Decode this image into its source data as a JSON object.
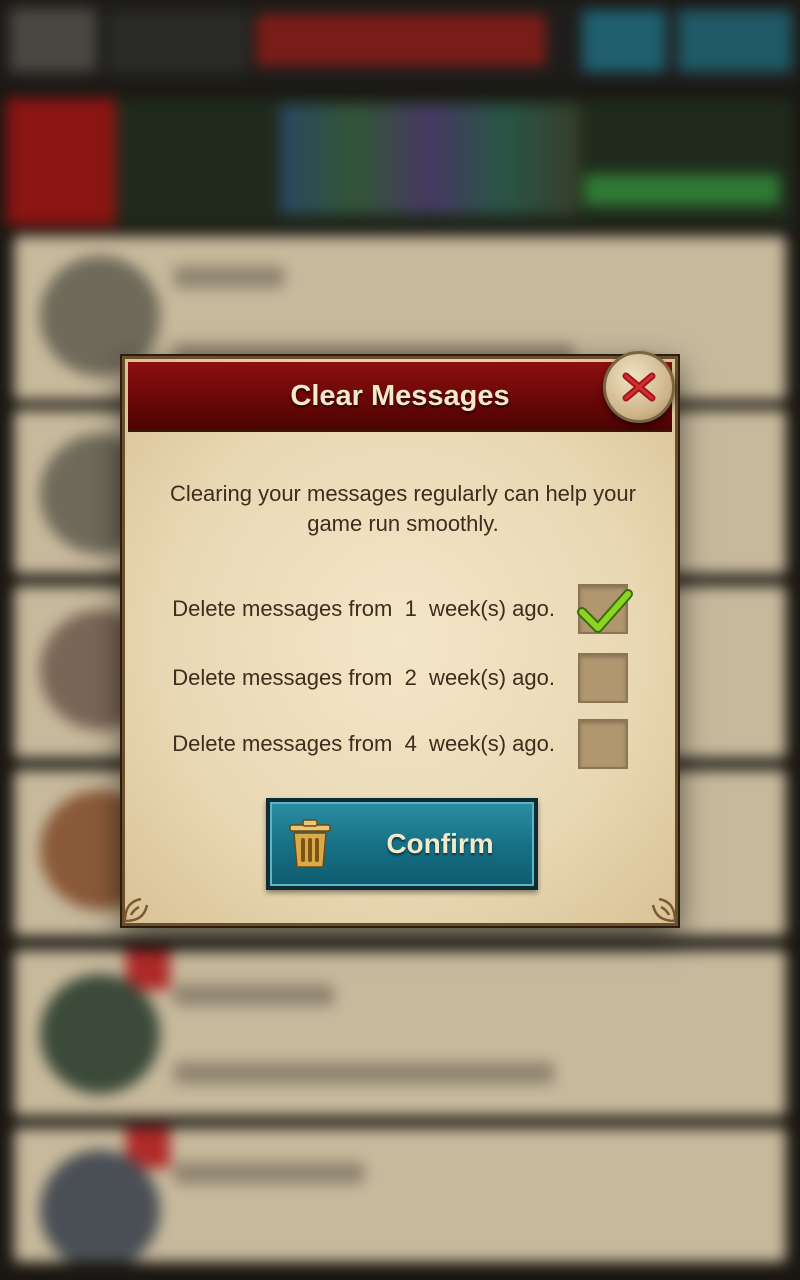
{
  "dialog": {
    "title": "Clear Messages",
    "description": "Clearing your messages regularly can help your game run smoothly.",
    "options": [
      {
        "label": "Delete messages from  1  week(s) ago.",
        "checked": true
      },
      {
        "label": "Delete messages from  2  week(s) ago.",
        "checked": false
      },
      {
        "label": "Delete messages from  4  week(s) ago.",
        "checked": false
      }
    ],
    "confirm_label": "Confirm",
    "icons": {
      "close": "close-x-icon",
      "confirm": "trash-icon",
      "check": "checkmark-icon"
    }
  },
  "colors": {
    "header_red": "#6a0707",
    "parchment": "#e9d8b4",
    "confirm_teal": "#177287",
    "check_green": "#8ad422",
    "text_brown": "#3e2c1c"
  }
}
